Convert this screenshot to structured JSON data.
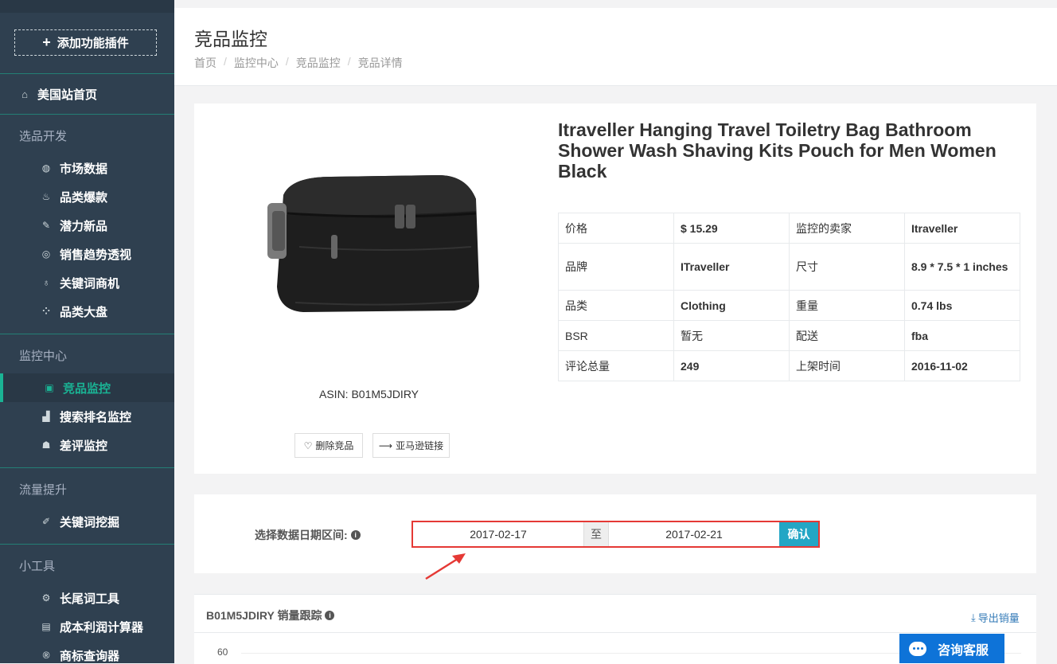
{
  "sidebar": {
    "add_plugin": "添加功能插件",
    "home": "美国站首页",
    "sections": [
      {
        "title": "选品开发",
        "items": [
          "市场数据",
          "品类爆款",
          "潜力新品",
          "销售趋势透视",
          "关键词商机",
          "品类大盘"
        ]
      },
      {
        "title": "监控中心",
        "items": [
          "竞品监控",
          "搜索排名监控",
          "差评监控"
        ]
      },
      {
        "title": "流量提升",
        "items": [
          "关键词挖掘"
        ]
      },
      {
        "title": "小工具",
        "items": [
          "长尾词工具",
          "成本利润计算器",
          "商标查询器"
        ]
      }
    ]
  },
  "header": {
    "title": "竞品监控",
    "breadcrumb": [
      "首页",
      "监控中心",
      "竞品监控",
      "竞品详情"
    ]
  },
  "product": {
    "title": "Itraveller Hanging Travel Toiletry Bag Bathroom Shower Wash Shaving Kits Pouch for Men Women Black",
    "asin": "ASIN: B01M5JDIRY",
    "delete_label": "删除竞品",
    "amazon_label": "亚马逊链接",
    "info": {
      "price_k": "价格",
      "price_v": "$ 15.29",
      "seller_k": "监控的卖家",
      "seller_v": "Itraveller",
      "brand_k": "品牌",
      "brand_v": "ITraveller",
      "size_k": "尺寸",
      "size_v": "8.9 * 7.5 * 1 inches",
      "cat_k": "品类",
      "cat_v": "Clothing",
      "weight_k": "重量",
      "weight_v": "0.74 lbs",
      "bsr_k": "BSR",
      "bsr_v": "暂无",
      "ship_k": "配送",
      "ship_v": "fba",
      "reviews_k": "评论总量",
      "reviews_v": "249",
      "listed_k": "上架时间",
      "listed_v": "2016-11-02"
    }
  },
  "date_range": {
    "label": "选择数据日期区间:",
    "start": "2017-02-17",
    "to": "至",
    "end": "2017-02-21",
    "confirm": "确认"
  },
  "chart": {
    "title": "B01M5JDIRY 销量跟踪",
    "export": "导出销量",
    "ytick_top": "60"
  },
  "chat": {
    "label": "咨询客服"
  },
  "colors": {
    "sidebar": "#2f4050",
    "accent": "#1ab394",
    "confirm": "#23a6c5",
    "highlight_border": "#e53935",
    "chat": "#0e73d8"
  }
}
